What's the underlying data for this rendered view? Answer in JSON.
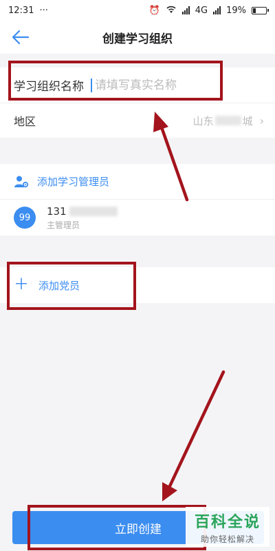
{
  "status_bar": {
    "time": "12:31",
    "dots": "···",
    "network": "4G",
    "battery_percent": "19%",
    "battery_level": 0.19
  },
  "nav": {
    "title": "创建学习组织",
    "back_icon": "arrow-left-icon"
  },
  "form": {
    "org_name_label": "学习组织名称",
    "org_name_placeholder": "请填写真实名称",
    "org_name_value": "",
    "region_label": "地区",
    "region_value_start": "山东",
    "region_value_end": "城"
  },
  "admin": {
    "section_label": "添加学习管理员",
    "avatar_text": "99",
    "phone_prefix": "131",
    "role": "主管理员"
  },
  "add_member_label": "添加党员",
  "create_button_label": "立即创建",
  "watermark": {
    "main": "百科全说",
    "sub": "助你轻松解决"
  },
  "colors": {
    "accent": "#3b8df0",
    "highlight": "#a3141c",
    "watermark": "#2aa55a"
  }
}
